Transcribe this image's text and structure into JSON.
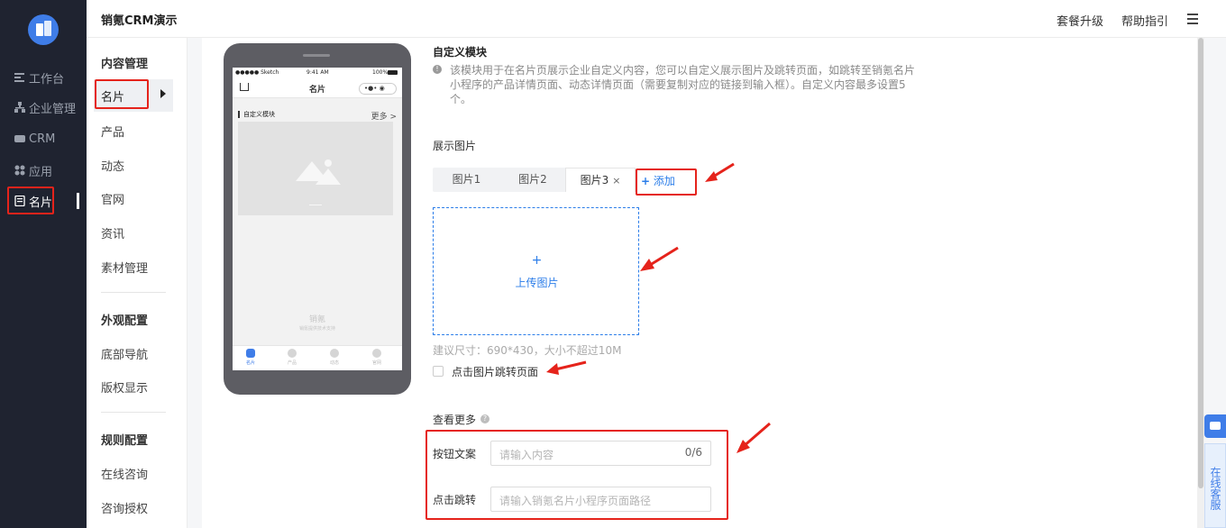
{
  "app_title": "销氪CRM演示",
  "top_links": {
    "upgrade": "套餐升级",
    "help": "帮助指引"
  },
  "left_nav": [
    {
      "label": "工作台",
      "icon": "dashboard-icon"
    },
    {
      "label": "企业管理",
      "icon": "org-icon"
    },
    {
      "label": "CRM",
      "icon": "crm-icon"
    },
    {
      "label": "应用",
      "icon": "apps-icon"
    },
    {
      "label": "名片",
      "icon": "card-icon",
      "active": true
    }
  ],
  "sub_nav": {
    "group1_title": "内容管理",
    "group1_items": [
      "名片",
      "产品",
      "动态",
      "官网",
      "资讯",
      "素材管理"
    ],
    "group2_title": "外观配置",
    "group2_items": [
      "底部导航",
      "版权显示"
    ],
    "group3_title": "规则配置",
    "group3_items": [
      "在线咨询",
      "咨询授权"
    ]
  },
  "phone": {
    "carrier": "●●●●● Sketch",
    "time": "9:41 AM",
    "battery": "100%",
    "nav_title": "名片",
    "capsule": "•●•  ◉",
    "module_title": "自定义模块",
    "more": "更多 >",
    "brand": "销氪",
    "brand_sub": "销氪提供技术支持",
    "tabs": [
      "名片",
      "产品",
      "动态",
      "官网"
    ]
  },
  "form": {
    "section_title": "自定义模块",
    "description": "该模块用于在名片页展示企业自定义内容，您可以自定义展示图片及跳转页面，如跳转至销氪名片小程序的产品详情页面、动态详情页面（需要复制对应的链接到输入框）。自定义内容最多设置5个。",
    "display_images_label": "展示图片",
    "image_tabs": [
      "图片1",
      "图片2",
      "图片3"
    ],
    "close_glyph": "×",
    "add_label": "添加",
    "add_plus": "+",
    "upload_plus": "+",
    "upload_label": "上传图片",
    "size_hint": "建议尺寸：690*430，大小不超过10M",
    "jump_checkbox_label": "点击图片跳转页面",
    "jump_checked": false,
    "see_more_label": "查看更多",
    "help_glyph": "?",
    "info_glyph": "!",
    "button_text_label": "按钮文案",
    "button_text_placeholder": "请输入内容",
    "button_text_count": "0/6",
    "click_jump_label": "点击跳转",
    "click_jump_placeholder": "请输入销氪名片小程序页面路径"
  },
  "float_widget": {
    "online_service": "在线客服"
  },
  "colors": {
    "accent": "#2b7de9",
    "highlight": "#e5231b",
    "nav_bg": "#1f2330"
  }
}
